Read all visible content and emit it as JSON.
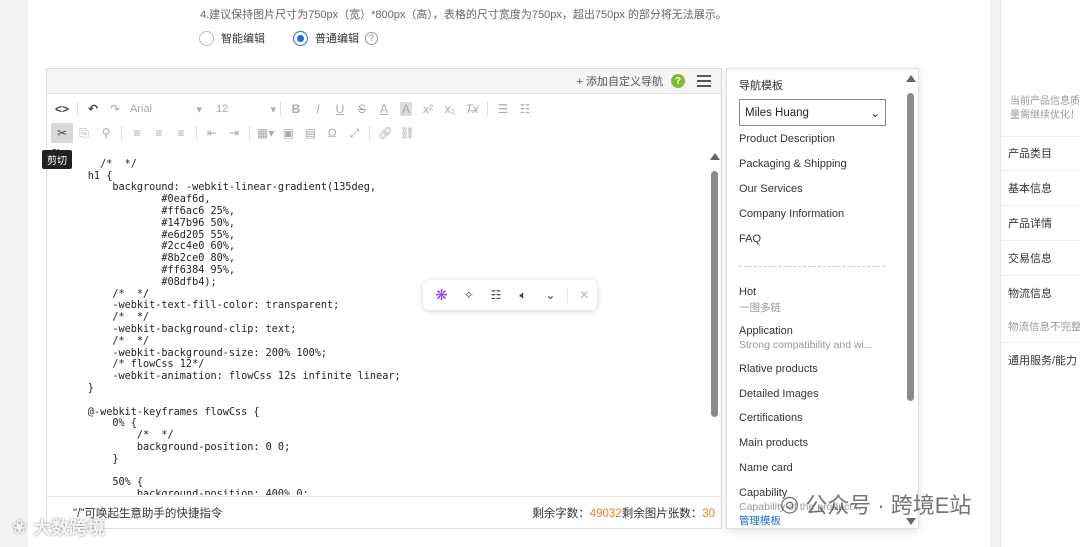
{
  "tip": "4.建议保持图片尺寸为750px（宽）*800px（高），表格的尺寸宽度为750px，超出750px 的部分将无法展示。",
  "mode": {
    "smart": "智能编辑",
    "normal": "普通编辑"
  },
  "editor": {
    "add_nav": "+ 添加自定义导航",
    "font_family": "Arial",
    "font_size": "12",
    "tooltip": "剪切",
    "code": "e>\n        /*  */\n      h1 {\n          background: -webkit-linear-gradient(135deg,\n                  #0eaf6d,\n                  #ff6ac6 25%,\n                  #147b96 50%,\n                  #e6d205 55%,\n                  #2cc4e0 60%,\n                  #8b2ce0 80%,\n                  #ff6384 95%,\n                  #08dfb4);\n          /*  */\n          -webkit-text-fill-color: transparent;\n          /*  */\n          -webkit-background-clip: text;\n          /*  */\n          -webkit-background-size: 200% 100%;\n          /* flowCss 12*/\n          -webkit-animation: flowCss 12s infinite linear;\n      }\n\n      @-webkit-keyframes flowCss {\n          0% {\n              /*  */\n              background-position: 0 0;\n          }\n\n          50% {\n              background-position: 400% 0;",
    "footer_hint": "\"/\"可唤起生意助手的快捷指令",
    "chars_label": "剩余字数：",
    "chars_value": "49032",
    "images_label": "剩余图片张数：",
    "images_value": "30"
  },
  "nav_panel": {
    "title": "导航模板",
    "selected": "Miles Huang",
    "items": [
      "Product Description",
      "Packaging & Shipping",
      "Our Services",
      "Company Information",
      "FAQ"
    ],
    "hot": {
      "label": "Hot",
      "sub": "一图多链"
    },
    "application": {
      "label": "Application",
      "sub": "Strong compatibility and wi..."
    },
    "items2": [
      "Rlative products",
      "Detailed Images",
      "Certifications",
      "Main products",
      "Name card",
      "Capability"
    ],
    "capability_sub": "Capability of the product...",
    "manage": "管理模板"
  },
  "right_panel": {
    "note": "当前产品信息质量需继续优化！",
    "items": [
      "产品类目",
      "基本信息",
      "产品详情",
      "交易信息",
      "物流信息"
    ],
    "gray_item": "物流信息不完整",
    "last": "通用服务/能力"
  },
  "watermarks": {
    "left": "大数跨境",
    "right_a": "公众号 · 跨境E站"
  },
  "colors": {
    "accent": "#1a6dd8",
    "count": "#f07e1d",
    "help": "#7bbd2a"
  }
}
